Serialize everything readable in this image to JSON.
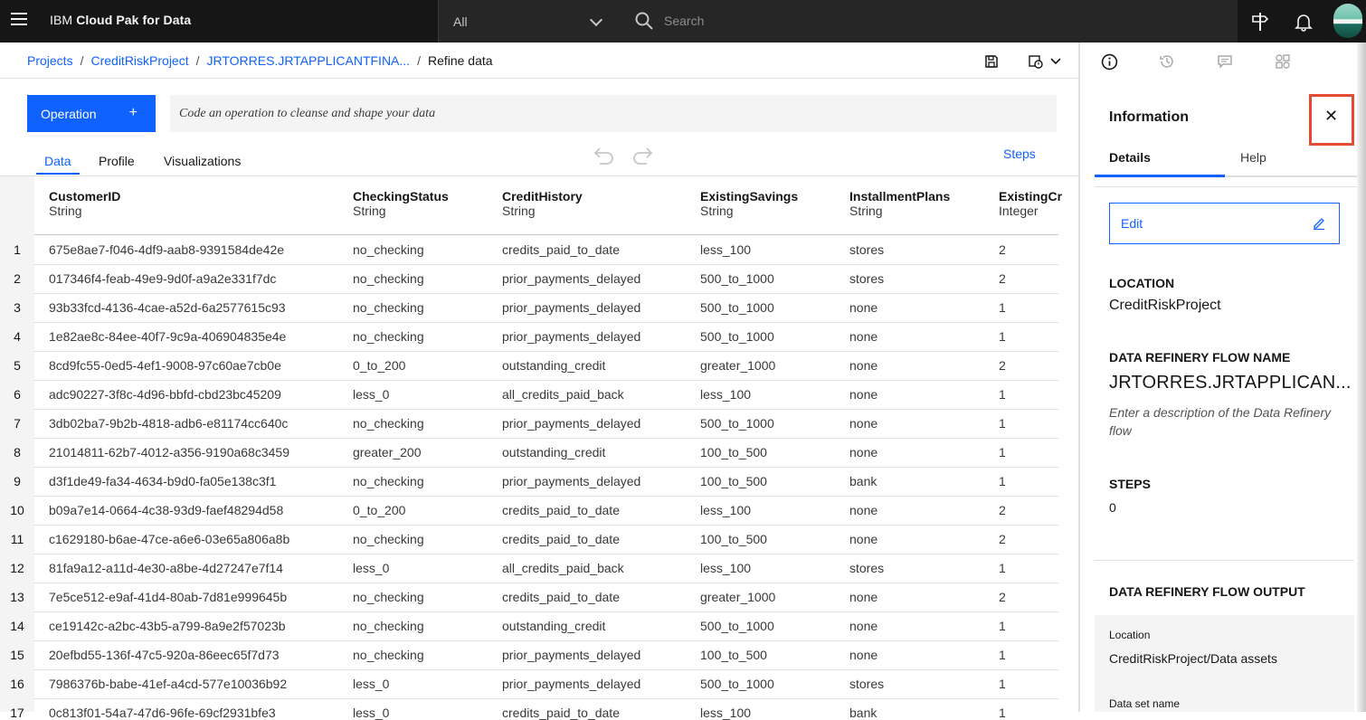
{
  "header": {
    "brand_prefix": "IBM",
    "brand_name": "Cloud Pak for Data",
    "scope_value": "All",
    "search_placeholder": "Search"
  },
  "breadcrumb": {
    "items": [
      "Projects",
      "CreditRiskProject",
      "JRTORRES.JRTAPPLICANTFINA..."
    ],
    "current": "Refine data",
    "separator": "/"
  },
  "toolbar": {
    "operation_label": "Operation",
    "operation_plus": "+",
    "code_placeholder": "Code an operation to cleanse and shape your data"
  },
  "tabs": [
    "Data",
    "Profile",
    "Visualizations"
  ],
  "steps_link": "Steps",
  "table": {
    "columns": [
      {
        "name": "CustomerID",
        "type": "String"
      },
      {
        "name": "CheckingStatus",
        "type": "String"
      },
      {
        "name": "CreditHistory",
        "type": "String"
      },
      {
        "name": "ExistingSavings",
        "type": "String"
      },
      {
        "name": "InstallmentPlans",
        "type": "String"
      },
      {
        "name": "ExistingCr",
        "type": "Integer"
      }
    ],
    "rows": [
      {
        "n": "1",
        "cells": [
          "675e8ae7-f046-4df9-aab8-9391584de42e",
          "no_checking",
          "credits_paid_to_date",
          "less_100",
          "stores",
          "2"
        ]
      },
      {
        "n": "2",
        "cells": [
          "017346f4-feab-49e9-9d0f-a9a2e331f7dc",
          "no_checking",
          "prior_payments_delayed",
          "500_to_1000",
          "stores",
          "2"
        ]
      },
      {
        "n": "3",
        "cells": [
          "93b33fcd-4136-4cae-a52d-6a2577615c93",
          "no_checking",
          "prior_payments_delayed",
          "500_to_1000",
          "none",
          "1"
        ]
      },
      {
        "n": "4",
        "cells": [
          "1e82ae8c-84ee-40f7-9c9a-406904835e4e",
          "no_checking",
          "prior_payments_delayed",
          "500_to_1000",
          "none",
          "1"
        ]
      },
      {
        "n": "5",
        "cells": [
          "8cd9fc55-0ed5-4ef1-9008-97c60ae7cb0e",
          "0_to_200",
          "outstanding_credit",
          "greater_1000",
          "none",
          "2"
        ]
      },
      {
        "n": "6",
        "cells": [
          "adc90227-3f8c-4d96-bbfd-cbd23bc45209",
          "less_0",
          "all_credits_paid_back",
          "less_100",
          "none",
          "1"
        ]
      },
      {
        "n": "7",
        "cells": [
          "3db02ba7-9b2b-4818-adb6-e81174cc640c",
          "no_checking",
          "prior_payments_delayed",
          "500_to_1000",
          "none",
          "1"
        ]
      },
      {
        "n": "8",
        "cells": [
          "21014811-62b7-4012-a356-9190a68c3459",
          "greater_200",
          "outstanding_credit",
          "100_to_500",
          "none",
          "1"
        ]
      },
      {
        "n": "9",
        "cells": [
          "d3f1de49-fa34-4634-b9d0-fa05e138c3f1",
          "no_checking",
          "prior_payments_delayed",
          "100_to_500",
          "bank",
          "1"
        ]
      },
      {
        "n": "10",
        "cells": [
          "b09a7e14-0664-4c38-93d9-faef48294d58",
          "0_to_200",
          "credits_paid_to_date",
          "less_100",
          "none",
          "2"
        ]
      },
      {
        "n": "11",
        "cells": [
          "c1629180-b6ae-47ce-a6e6-03e65a806a8b",
          "no_checking",
          "credits_paid_to_date",
          "100_to_500",
          "none",
          "2"
        ]
      },
      {
        "n": "12",
        "cells": [
          "81fa9a12-a11d-4e30-a8be-4d27247e7f14",
          "less_0",
          "all_credits_paid_back",
          "less_100",
          "stores",
          "1"
        ]
      },
      {
        "n": "13",
        "cells": [
          "7e5ce512-e9af-41d4-80ab-7d81e999645b",
          "no_checking",
          "credits_paid_to_date",
          "greater_1000",
          "none",
          "2"
        ]
      },
      {
        "n": "14",
        "cells": [
          "ce19142c-a2bc-43b5-a799-8a9e2f57023b",
          "no_checking",
          "outstanding_credit",
          "500_to_1000",
          "none",
          "1"
        ]
      },
      {
        "n": "15",
        "cells": [
          "20efbd55-136f-47c5-920a-86eec65f7d73",
          "no_checking",
          "prior_payments_delayed",
          "100_to_500",
          "none",
          "1"
        ]
      },
      {
        "n": "16",
        "cells": [
          "7986376b-babe-41ef-a4cd-577e10036b92",
          "less_0",
          "prior_payments_delayed",
          "500_to_1000",
          "stores",
          "1"
        ]
      },
      {
        "n": "17",
        "cells": [
          "0c813f01-54a7-47d6-96fe-69cf2931bfe3",
          "less_0",
          "credits_paid_to_date",
          "less_100",
          "bank",
          "1"
        ]
      }
    ]
  },
  "panel": {
    "title": "Information",
    "close_glyph": "✕",
    "tabs": [
      "Details",
      "Help"
    ],
    "edit_label": "Edit",
    "location_label": "LOCATION",
    "location_value": "CreditRiskProject",
    "flow_name_label": "DATA REFINERY FLOW NAME",
    "flow_name_value": "JRTORRES.JRTAPPLICAN...",
    "flow_description": "Enter a description of the Data Refinery flow",
    "steps_label": "STEPS",
    "steps_value": "0",
    "output_label": "DATA REFINERY FLOW OUTPUT",
    "output_location_label": "Location",
    "output_location_value": "CreditRiskProject/Data assets",
    "output_dataset_label": "Data set name"
  },
  "colors": {
    "accent": "#0f62fe",
    "topbar": "#161616",
    "highlight_border": "#e34b35"
  }
}
